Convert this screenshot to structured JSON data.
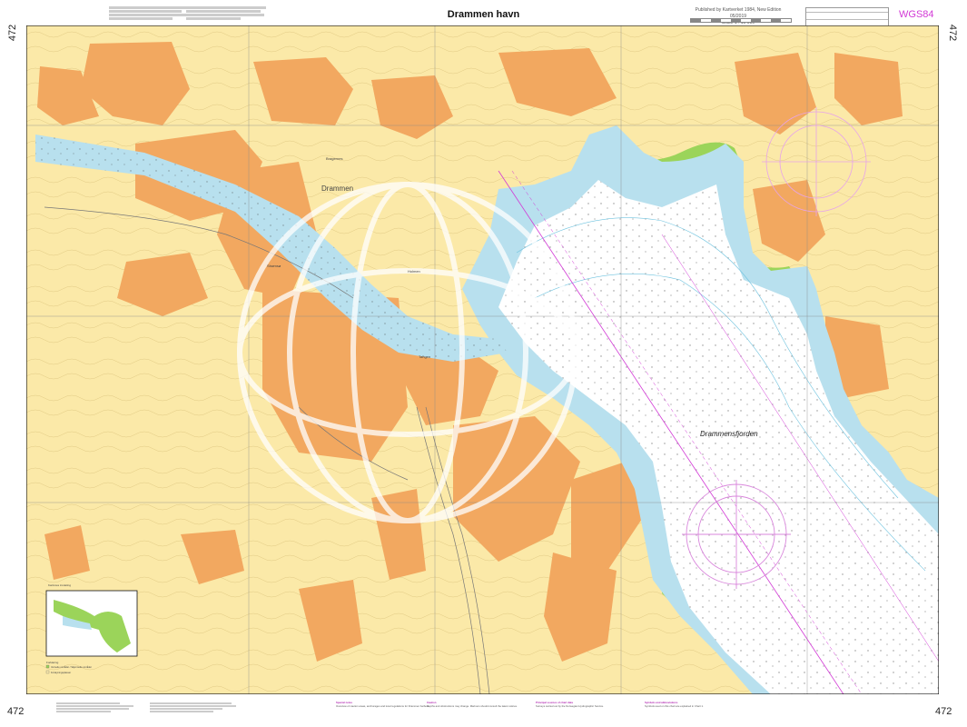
{
  "chart_number": "472",
  "title": "Drammen havn",
  "datum": "WGS84",
  "publisher_lines": [
    "Published by Kartverket 1984, New Edition 05/2019",
    "Scale 1 : 10 000"
  ],
  "place_names": {
    "fjord": "Drammensfjorden",
    "city": "Drammen",
    "district_1": "Bragernes",
    "district_2": "Strømsø",
    "island": "Holmen",
    "district_3": "Tangen"
  },
  "inset": {
    "label": "Kartrutes inndeling",
    "legend_title": "Forklaring",
    "legend_items": [
      "Vernede områder / Skjermede områder",
      "Fortøyningsplasser"
    ]
  },
  "colors": {
    "water_shallow": "#b8e0ee",
    "water_deep": "#ffffff",
    "land": "#fbe9a8",
    "built_up": "#f2a860",
    "green": "#9bd45a",
    "magenta": "#d23ad6"
  },
  "bottom_notes": [
    {
      "heading": "Special notes",
      "body": "Overview of caution areas, anchorages and local regulations for Drammen harbour."
    },
    {
      "heading": "Caution",
      "body": "Depths and obstructions may change. Mariners should consult the latest notices."
    },
    {
      "heading": "Principal sources of chart data",
      "body": "Surveys carried out by the Norwegian Hydrographic Service."
    },
    {
      "heading": "Symbols and abbreviations",
      "body": "Symbols used on this chart are explained in Chart 1."
    }
  ]
}
